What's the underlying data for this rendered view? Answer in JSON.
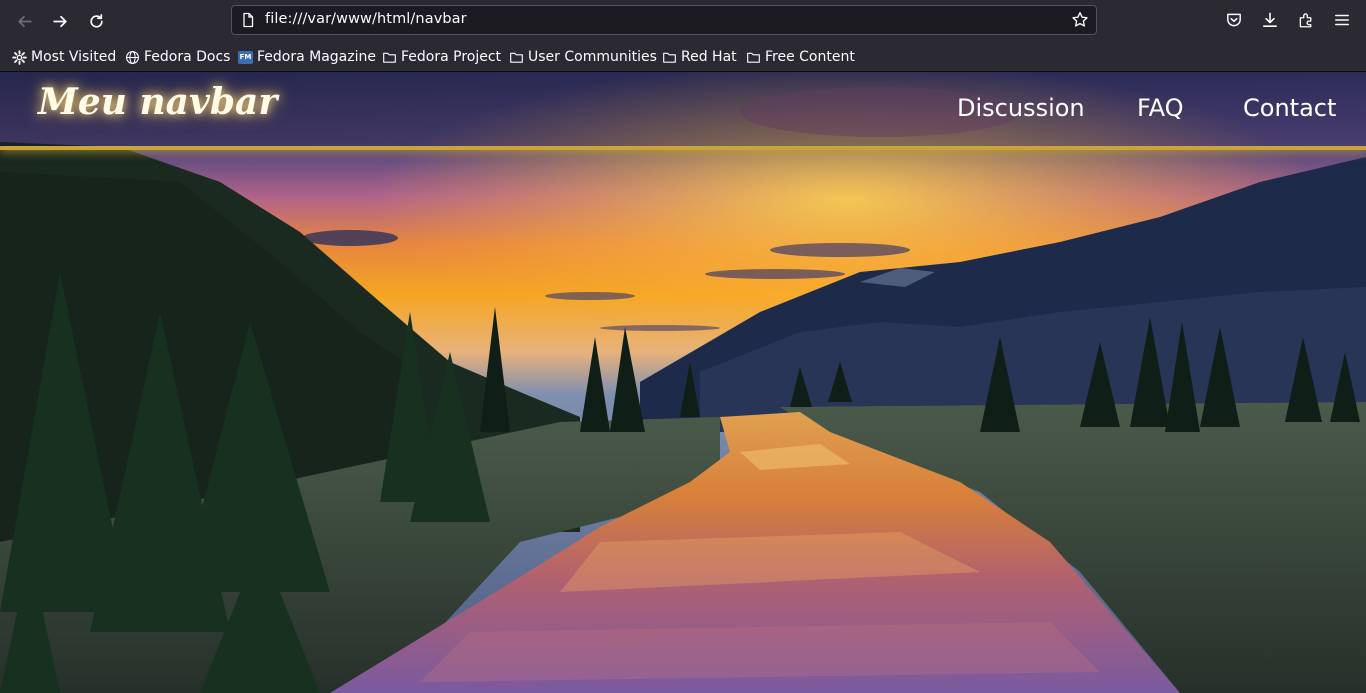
{
  "browser": {
    "url": "file:///var/www/html/navbar",
    "bookmarks": [
      {
        "label": "Most Visited",
        "icon": "gear-icon"
      },
      {
        "label": "Fedora Docs",
        "icon": "globe-icon"
      },
      {
        "label": "Fedora Magazine",
        "icon": "fedora-magazine-icon",
        "badge": "FM"
      },
      {
        "label": "Fedora Project",
        "icon": "folder-icon"
      },
      {
        "label": "User Communities",
        "icon": "folder-icon"
      },
      {
        "label": "Red Hat",
        "icon": "folder-icon"
      },
      {
        "label": "Free Content",
        "icon": "folder-icon"
      }
    ]
  },
  "page": {
    "brand": "Meu navbar",
    "menu": [
      "Discussion",
      "FAQ",
      "Contact"
    ],
    "accent_color": "#c9a43a"
  }
}
